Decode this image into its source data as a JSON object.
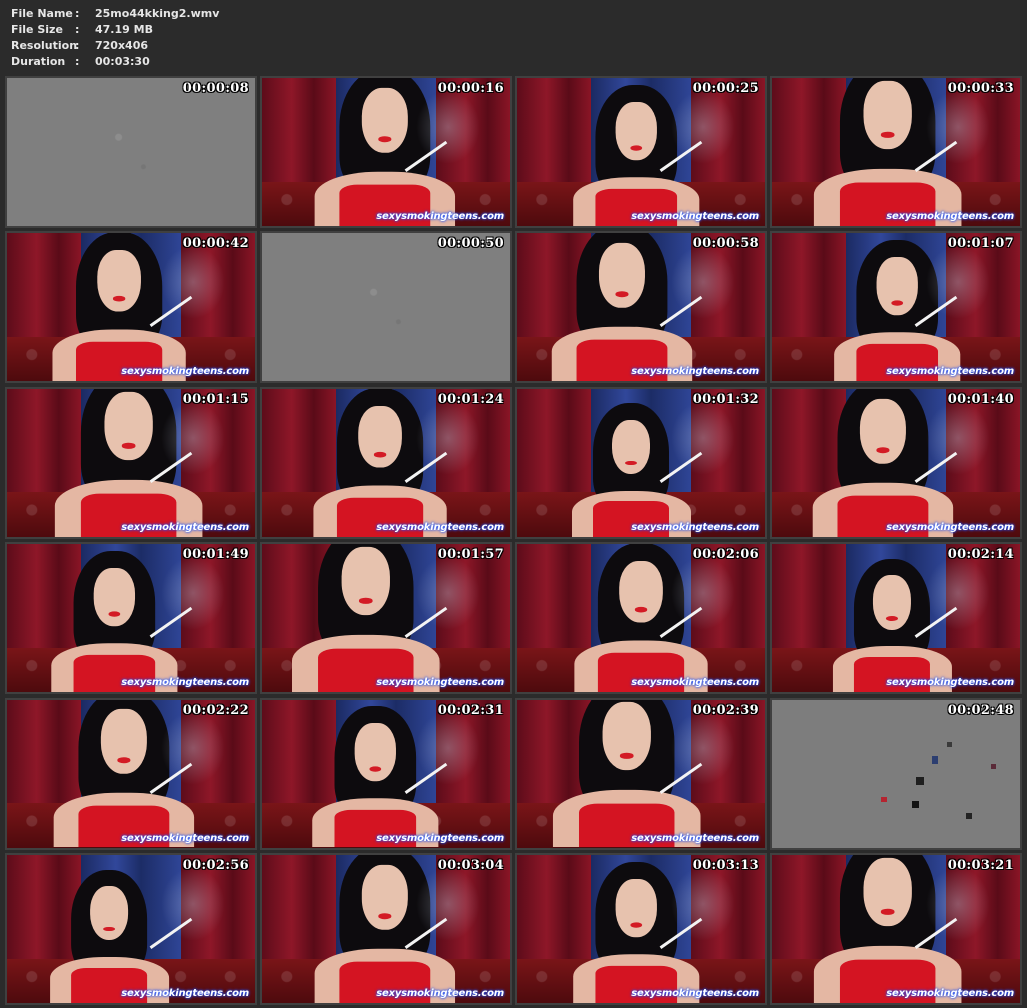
{
  "file_info": {
    "rows": [
      {
        "label": "File Name",
        "sep": ":",
        "value": "25mo44kking2.wmv"
      },
      {
        "label": "File Size",
        "sep": ":",
        "value": "47.19 MB"
      },
      {
        "label": "Resolution",
        "sep": ":",
        "value": "720x406"
      },
      {
        "label": "Duration",
        "sep": ":",
        "value": "00:03:30"
      }
    ]
  },
  "thumbnails": [
    {
      "time": "00:00:08",
      "scene": "gray",
      "watermark": ""
    },
    {
      "time": "00:00:16",
      "scene": "video",
      "watermark": "sexysmokingteens.com"
    },
    {
      "time": "00:00:25",
      "scene": "video",
      "watermark": "sexysmokingteens.com"
    },
    {
      "time": "00:00:33",
      "scene": "video",
      "watermark": "sexysmokingteens.com"
    },
    {
      "time": "00:00:42",
      "scene": "video",
      "watermark": "sexysmokingteens.com"
    },
    {
      "time": "00:00:50",
      "scene": "gray",
      "watermark": ""
    },
    {
      "time": "00:00:58",
      "scene": "video",
      "watermark": "sexysmokingteens.com"
    },
    {
      "time": "00:01:07",
      "scene": "video",
      "watermark": "sexysmokingteens.com"
    },
    {
      "time": "00:01:15",
      "scene": "video",
      "watermark": "sexysmokingteens.com"
    },
    {
      "time": "00:01:24",
      "scene": "video",
      "watermark": "sexysmokingteens.com"
    },
    {
      "time": "00:01:32",
      "scene": "video",
      "watermark": "sexysmokingteens.com"
    },
    {
      "time": "00:01:40",
      "scene": "video",
      "watermark": "sexysmokingteens.com"
    },
    {
      "time": "00:01:49",
      "scene": "video",
      "watermark": "sexysmokingteens.com"
    },
    {
      "time": "00:01:57",
      "scene": "video",
      "watermark": "sexysmokingteens.com"
    },
    {
      "time": "00:02:06",
      "scene": "video",
      "watermark": "sexysmokingteens.com"
    },
    {
      "time": "00:02:14",
      "scene": "video",
      "watermark": "sexysmokingteens.com"
    },
    {
      "time": "00:02:22",
      "scene": "video",
      "watermark": "sexysmokingteens.com"
    },
    {
      "time": "00:02:31",
      "scene": "video",
      "watermark": "sexysmokingteens.com"
    },
    {
      "time": "00:02:39",
      "scene": "video",
      "watermark": "sexysmokingteens.com"
    },
    {
      "time": "00:02:48",
      "scene": "gray-blocks",
      "watermark": ""
    },
    {
      "time": "00:02:56",
      "scene": "video",
      "watermark": "sexysmokingteens.com"
    },
    {
      "time": "00:03:04",
      "scene": "video",
      "watermark": "sexysmokingteens.com"
    },
    {
      "time": "00:03:13",
      "scene": "video",
      "watermark": "sexysmokingteens.com"
    },
    {
      "time": "00:03:21",
      "scene": "video",
      "watermark": "sexysmokingteens.com"
    }
  ],
  "colors": {
    "background": "#2b2b2b",
    "thumb_border": "#404040",
    "header_text": "#e6e6e6",
    "timestamp_text": "#ffffff",
    "watermark_glow": "#1a52ff"
  }
}
